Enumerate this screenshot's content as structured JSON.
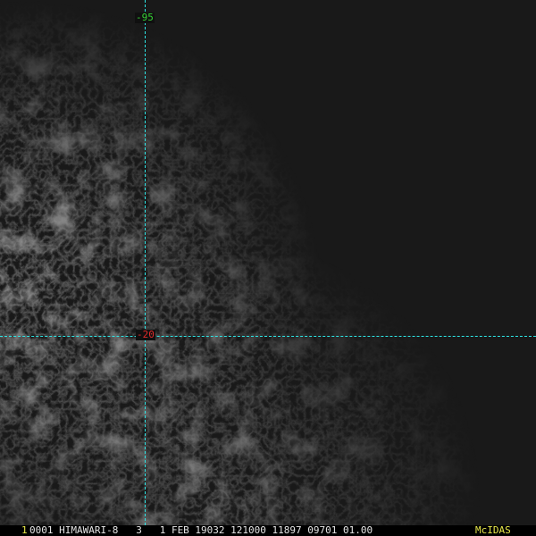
{
  "grid": {
    "longitude_label": "-95",
    "latitude_label": "-20"
  },
  "colors": {
    "grid_line": "#2ee6e6",
    "longitude_label": "#35d235",
    "latitude_label": "#e22a2a",
    "frame_number": "#e8e84a",
    "status_text": "#e6e6e6",
    "logo": "#e8e84a"
  },
  "status_bar": {
    "frame_number": "1",
    "header": "0001 HIMAWARI-8   3   1 FEB 19032 121000 11897 09701 01.00",
    "logo": "McIDAS"
  }
}
